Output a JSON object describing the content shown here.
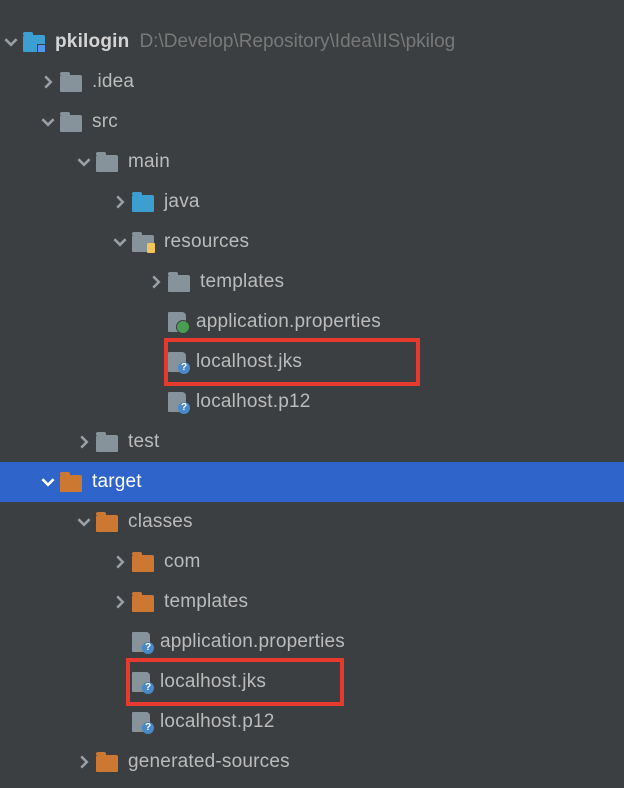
{
  "root": {
    "name": "pkilogin",
    "path": "D:\\Develop\\Repository\\Idea\\IIS\\pkilog"
  },
  "tree": {
    "idea": ".idea",
    "src": "src",
    "main": "main",
    "java": "java",
    "resources": "resources",
    "templates": "templates",
    "app_props": "application.properties",
    "localhost_jks": "localhost.jks",
    "localhost_p12": "localhost.p12",
    "test": "test",
    "target": "target",
    "classes": "classes",
    "com": "com",
    "templates2": "templates",
    "app_props2": "application.properties",
    "localhost_jks2": "localhost.jks",
    "localhost_p122": "localhost.p12",
    "generated_sources": "generated-sources"
  }
}
